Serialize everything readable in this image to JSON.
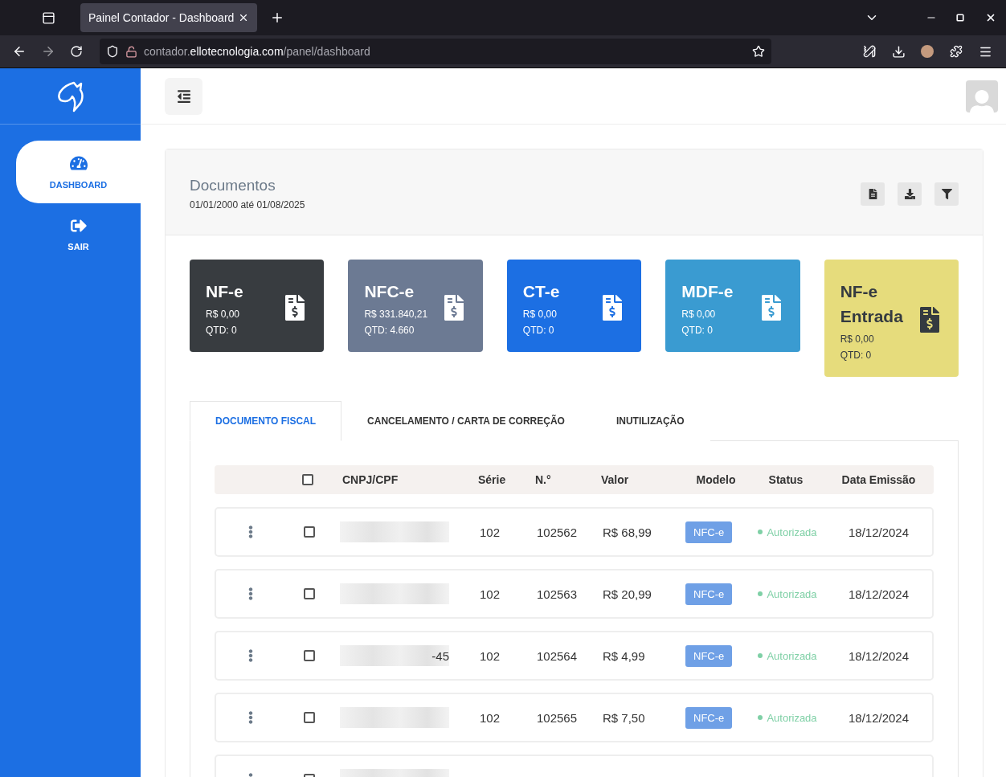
{
  "browser": {
    "tabs": [
      {
        "title": "Painel Contador - Dashboard",
        "selected": true
      }
    ],
    "url": {
      "prefix": "contador.",
      "domain": "ellotecnologia.com",
      "path": "/panel/dashboard"
    }
  },
  "sidebar": {
    "items": [
      {
        "label": "DASHBOARD",
        "kind": "gauge",
        "selected": true
      },
      {
        "label": "SAIR",
        "kind": "logout",
        "selected": false
      }
    ]
  },
  "documents": {
    "title": "Documentos",
    "period": "01/01/2000 até 01/08/2025",
    "cards": [
      {
        "title": "NF-e",
        "amount": "R$ 0,00",
        "quantity": "QTD: 0",
        "color": "#383c40"
      },
      {
        "title": "NFC-e",
        "amount": "R$ 331.840,21",
        "quantity": "QTD: 4.660",
        "color": "#6c7a93"
      },
      {
        "title": "CT-e",
        "amount": "R$ 0,00",
        "quantity": "QTD: 0",
        "color": "#1c6fe3"
      },
      {
        "title": "MDF-e",
        "amount": "R$ 0,00",
        "quantity": "QTD: 0",
        "color": "#3a9bd1"
      },
      {
        "title": "NF-e Entrada",
        "amount": "R$ 0,00",
        "quantity": "QTD: 0",
        "color": "#e6dc7c"
      }
    ],
    "tabs": [
      {
        "label": "DOCUMENTO FISCAL",
        "selected": true
      },
      {
        "label": "CANCELAMENTO / CARTA DE CORREÇÃO",
        "selected": false
      },
      {
        "label": "INUTILIZAÇÃO",
        "selected": false
      }
    ],
    "table": {
      "select_all": {
        "checked": false
      },
      "columns": [
        "CNPJ/CPF",
        "Série",
        "N.°",
        "Valor",
        "Modelo",
        "Status",
        "Data Emissão"
      ],
      "rows": [
        {
          "checked": false,
          "serie": "102",
          "numero": "102562",
          "valor": "R$ 68,99",
          "modelo": "NFC-e",
          "status": "Autorizada",
          "data": "18/12/2024"
        },
        {
          "checked": false,
          "serie": "102",
          "numero": "102563",
          "valor": "R$ 20,99",
          "modelo": "NFC-e",
          "status": "Autorizada",
          "data": "18/12/2024"
        },
        {
          "checked": false,
          "cnpj_tail": "-45",
          "serie": "102",
          "numero": "102564",
          "valor": "R$ 4,99",
          "modelo": "NFC-e",
          "status": "Autorizada",
          "data": "18/12/2024"
        },
        {
          "checked": false,
          "serie": "102",
          "numero": "102565",
          "valor": "R$ 7,50",
          "modelo": "NFC-e",
          "status": "Autorizada",
          "data": "18/12/2024"
        },
        {
          "checked": false
        }
      ]
    }
  }
}
